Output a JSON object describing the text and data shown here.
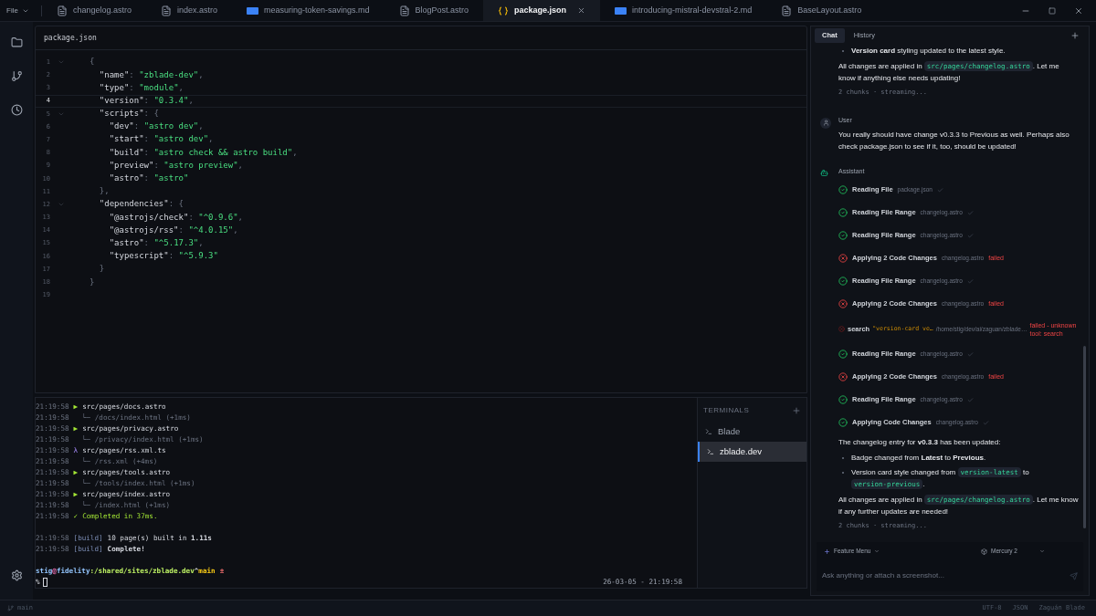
{
  "menu": {
    "label": "File"
  },
  "tabs": [
    {
      "label": "changelog.astro",
      "kind": "file",
      "selected": false
    },
    {
      "label": "index.astro",
      "kind": "file",
      "selected": false
    },
    {
      "label": "measuring-token-savings.md",
      "kind": "md",
      "selected": false
    },
    {
      "label": "BlogPost.astro",
      "kind": "file",
      "selected": false
    },
    {
      "label": "package.json",
      "kind": "json",
      "selected": true
    },
    {
      "label": "introducing-mistral-devstral-2.md",
      "kind": "md",
      "selected": false
    },
    {
      "label": "BaseLayout.astro",
      "kind": "file",
      "selected": false
    }
  ],
  "editor": {
    "filename": "package.json",
    "lines": [
      {
        "number": "1",
        "fold": true,
        "current": false,
        "tokens": [
          {
            "t": "{",
            "kind": "punc"
          }
        ]
      },
      {
        "number": "2",
        "fold": false,
        "current": false,
        "tokens": [
          {
            "t": "  \"name\"",
            "kind": "key"
          },
          {
            "t": ": ",
            "kind": "punc"
          },
          {
            "t": "\"zblade-dev\"",
            "kind": "str"
          },
          {
            "t": ",",
            "kind": "punc"
          }
        ]
      },
      {
        "number": "3",
        "fold": false,
        "current": false,
        "tokens": [
          {
            "t": "  \"type\"",
            "kind": "key"
          },
          {
            "t": ": ",
            "kind": "punc"
          },
          {
            "t": "\"module\"",
            "kind": "str"
          },
          {
            "t": ",",
            "kind": "punc"
          }
        ]
      },
      {
        "number": "4",
        "fold": false,
        "current": true,
        "tokens": [
          {
            "t": "  \"version\"",
            "kind": "key"
          },
          {
            "t": ": ",
            "kind": "punc"
          },
          {
            "t": "\"0.3.4\"",
            "kind": "str"
          },
          {
            "t": ",",
            "kind": "punc"
          }
        ]
      },
      {
        "number": "5",
        "fold": true,
        "current": false,
        "tokens": [
          {
            "t": "  \"scripts\"",
            "kind": "key"
          },
          {
            "t": ": {",
            "kind": "punc"
          }
        ]
      },
      {
        "number": "6",
        "fold": false,
        "current": false,
        "tokens": [
          {
            "t": "    \"dev\"",
            "kind": "key"
          },
          {
            "t": ": ",
            "kind": "punc"
          },
          {
            "t": "\"astro dev\"",
            "kind": "str"
          },
          {
            "t": ",",
            "kind": "punc"
          }
        ]
      },
      {
        "number": "7",
        "fold": false,
        "current": false,
        "tokens": [
          {
            "t": "    \"start\"",
            "kind": "key"
          },
          {
            "t": ": ",
            "kind": "punc"
          },
          {
            "t": "\"astro dev\"",
            "kind": "str"
          },
          {
            "t": ",",
            "kind": "punc"
          }
        ]
      },
      {
        "number": "8",
        "fold": false,
        "current": false,
        "tokens": [
          {
            "t": "    \"build\"",
            "kind": "key"
          },
          {
            "t": ": ",
            "kind": "punc"
          },
          {
            "t": "\"astro check && astro build\"",
            "kind": "str"
          },
          {
            "t": ",",
            "kind": "punc"
          }
        ]
      },
      {
        "number": "9",
        "fold": false,
        "current": false,
        "tokens": [
          {
            "t": "    \"preview\"",
            "kind": "key"
          },
          {
            "t": ": ",
            "kind": "punc"
          },
          {
            "t": "\"astro preview\"",
            "kind": "str"
          },
          {
            "t": ",",
            "kind": "punc"
          }
        ]
      },
      {
        "number": "10",
        "fold": false,
        "current": false,
        "tokens": [
          {
            "t": "    \"astro\"",
            "kind": "key"
          },
          {
            "t": ": ",
            "kind": "punc"
          },
          {
            "t": "\"astro\"",
            "kind": "str"
          }
        ]
      },
      {
        "number": "11",
        "fold": false,
        "current": false,
        "tokens": [
          {
            "t": "  },",
            "kind": "punc"
          }
        ]
      },
      {
        "number": "12",
        "fold": true,
        "current": false,
        "tokens": [
          {
            "t": "  \"dependencies\"",
            "kind": "key"
          },
          {
            "t": ": {",
            "kind": "punc"
          }
        ]
      },
      {
        "number": "13",
        "fold": false,
        "current": false,
        "tokens": [
          {
            "t": "    \"@astrojs/check\"",
            "kind": "key"
          },
          {
            "t": ": ",
            "kind": "punc"
          },
          {
            "t": "\"^0.9.6\"",
            "kind": "str"
          },
          {
            "t": ",",
            "kind": "punc"
          }
        ]
      },
      {
        "number": "14",
        "fold": false,
        "current": false,
        "tokens": [
          {
            "t": "    \"@astrojs/rss\"",
            "kind": "key"
          },
          {
            "t": ": ",
            "kind": "punc"
          },
          {
            "t": "\"^4.0.15\"",
            "kind": "str"
          },
          {
            "t": ",",
            "kind": "punc"
          }
        ]
      },
      {
        "number": "15",
        "fold": false,
        "current": false,
        "tokens": [
          {
            "t": "    \"astro\"",
            "kind": "key"
          },
          {
            "t": ": ",
            "kind": "punc"
          },
          {
            "t": "\"^5.17.3\"",
            "kind": "str"
          },
          {
            "t": ",",
            "kind": "punc"
          }
        ]
      },
      {
        "number": "16",
        "fold": false,
        "current": false,
        "tokens": [
          {
            "t": "    \"typescript\"",
            "kind": "key"
          },
          {
            "t": ": ",
            "kind": "punc"
          },
          {
            "t": "\"^5.9.3\"",
            "kind": "str"
          }
        ]
      },
      {
        "number": "17",
        "fold": false,
        "current": false,
        "tokens": [
          {
            "t": "  }",
            "kind": "punc"
          }
        ]
      },
      {
        "number": "18",
        "fold": false,
        "current": false,
        "tokens": [
          {
            "t": "}",
            "kind": "punc"
          }
        ]
      },
      {
        "number": "19",
        "fold": false,
        "current": false
      }
    ]
  },
  "terminal": {
    "lines": [
      {
        "time": "21:19:58",
        "kind": "page",
        "marker": "▶",
        "text": "src/pages/docs.astro"
      },
      {
        "time": "21:19:58",
        "kind": "route",
        "marker": "└─",
        "text": "/docs/index.html (+1ms)"
      },
      {
        "time": "21:19:58",
        "kind": "page",
        "marker": "▶",
        "text": "src/pages/privacy.astro"
      },
      {
        "time": "21:19:58",
        "kind": "route",
        "marker": "└─",
        "text": "/privacy/index.html (+1ms)"
      },
      {
        "time": "21:19:58",
        "kind": "lambda",
        "marker": "λ",
        "text": "src/pages/rss.xml.ts"
      },
      {
        "time": "21:19:58",
        "kind": "route",
        "marker": "└─",
        "text": "/rss.xml (+4ms)"
      },
      {
        "time": "21:19:58",
        "kind": "page",
        "marker": "▶",
        "text": "src/pages/tools.astro"
      },
      {
        "time": "21:19:58",
        "kind": "route",
        "marker": "└─",
        "text": "/tools/index.html (+1ms)"
      },
      {
        "time": "21:19:58",
        "kind": "page",
        "marker": "▶",
        "text": "src/pages/index.astro"
      },
      {
        "time": "21:19:58",
        "kind": "route",
        "marker": "└─",
        "text": "/index.html (+1ms)"
      },
      {
        "time": "21:19:58",
        "kind": "done",
        "marker": "✓",
        "text": "Completed in 37ms."
      },
      {
        "kind": "blank"
      },
      {
        "time": "21:19:58",
        "kind": "build",
        "marker": "[build]",
        "text": "10 page(s) built in **1.11s**"
      },
      {
        "time": "21:19:58",
        "kind": "build",
        "marker": "[build]",
        "text": "**Complete!**"
      },
      {
        "kind": "blank"
      }
    ],
    "prompt": {
      "user": "stig",
      "at": "@",
      "host": "fidelity",
      "path": ":/shared/sites/zblade.dev",
      "caret": "^",
      "branch": "main",
      "dirty": "±",
      "symbol": "%",
      "timestamp": "26-03-05 - 21:19:58"
    },
    "list_title": "TERMINALS",
    "sessions": [
      {
        "name": "Blade",
        "selected": false
      },
      {
        "name": "zblade.dev",
        "selected": true
      }
    ]
  },
  "chat": {
    "tabs": [
      {
        "label": "Chat",
        "selected": true
      },
      {
        "label": "History",
        "selected": false
      }
    ],
    "messages": [
      {
        "blocks": [
          {
            "kind": "bullets",
            "items": [
              [
                {
                  "text": "**Version card** styling updated to the latest style."
                }
              ]
            ]
          },
          {
            "kind": "para",
            "parts": [
              {
                "text": "All changes are applied in "
              },
              {
                "code": "src/pages/changelog.astro"
              },
              {
                "text": ". Let me know if anything else needs updating!"
              }
            ]
          },
          {
            "kind": "meta",
            "text": "2 chunks · streaming..."
          }
        ]
      },
      {
        "kind": "user",
        "author": "User",
        "blocks": [
          {
            "kind": "para",
            "parts": [
              {
                "text": "You really should have change v0.3.3 to Previous as well. Perhaps also check package.json to see if it, too, should be updated!"
              }
            ]
          }
        ]
      },
      {
        "kind": "assistant",
        "author": "Assistant",
        "blocks": [
          {
            "kind": "tool_ok",
            "label": "Reading File",
            "file": "package.json"
          },
          {
            "kind": "tool_ok",
            "label": "Reading File Range",
            "file": "changelog.astro"
          },
          {
            "kind": "tool_ok",
            "label": "Reading File Range",
            "file": "changelog.astro"
          },
          {
            "kind": "tool_failed",
            "label": "Applying 2 Code Changes",
            "file": "changelog.astro",
            "note": "failed"
          },
          {
            "kind": "tool_ok",
            "label": "Reading File Range",
            "file": "changelog.astro"
          },
          {
            "kind": "tool_failed",
            "label": "Applying 2 Code Changes",
            "file": "changelog.astro",
            "note": "failed"
          },
          {
            "kind": "search",
            "label": "search",
            "query": "\"version-card ve…",
            "file": "/home/stig/dev/ai/zaguan/zblade…",
            "note": "failed - unknown tool: search"
          },
          {
            "kind": "tool_ok",
            "label": "Reading File Range",
            "file": "changelog.astro"
          },
          {
            "kind": "tool_failed",
            "label": "Applying 2 Code Changes",
            "file": "changelog.astro",
            "note": "failed"
          },
          {
            "kind": "tool_ok",
            "label": "Reading File Range",
            "file": "changelog.astro"
          },
          {
            "kind": "tool_ok",
            "label": "Applying Code Changes",
            "file": "changelog.astro"
          },
          {
            "kind": "para",
            "parts": [
              {
                "text": "The changelog entry for **v0.3.3** has been updated:"
              }
            ]
          },
          {
            "kind": "bullets",
            "items": [
              [
                {
                  "text": "Badge changed from **Latest** to **Previous**."
                }
              ],
              [
                {
                  "text": "Version card style changed from "
                },
                {
                  "code": "version-latest"
                },
                {
                  "text": " to "
                },
                {
                  "code": "version-previous"
                },
                {
                  "text": "."
                }
              ]
            ]
          },
          {
            "kind": "para",
            "parts": [
              {
                "text": "All changes are applied in "
              },
              {
                "code": "src/pages/changelog.astro"
              },
              {
                "text": ". Let me know if any further updates are needed!"
              }
            ]
          },
          {
            "kind": "meta",
            "text": "2 chunks · streaming..."
          }
        ]
      }
    ],
    "feature_menu": "Feature Menu",
    "model": "Mercury 2",
    "input_placeholder": "Ask anything or attach a screenshot..."
  },
  "status_bar": {
    "branch": "main",
    "encoding": "UTF-8",
    "language": "JSON",
    "app": "Zaguán Blade"
  }
}
